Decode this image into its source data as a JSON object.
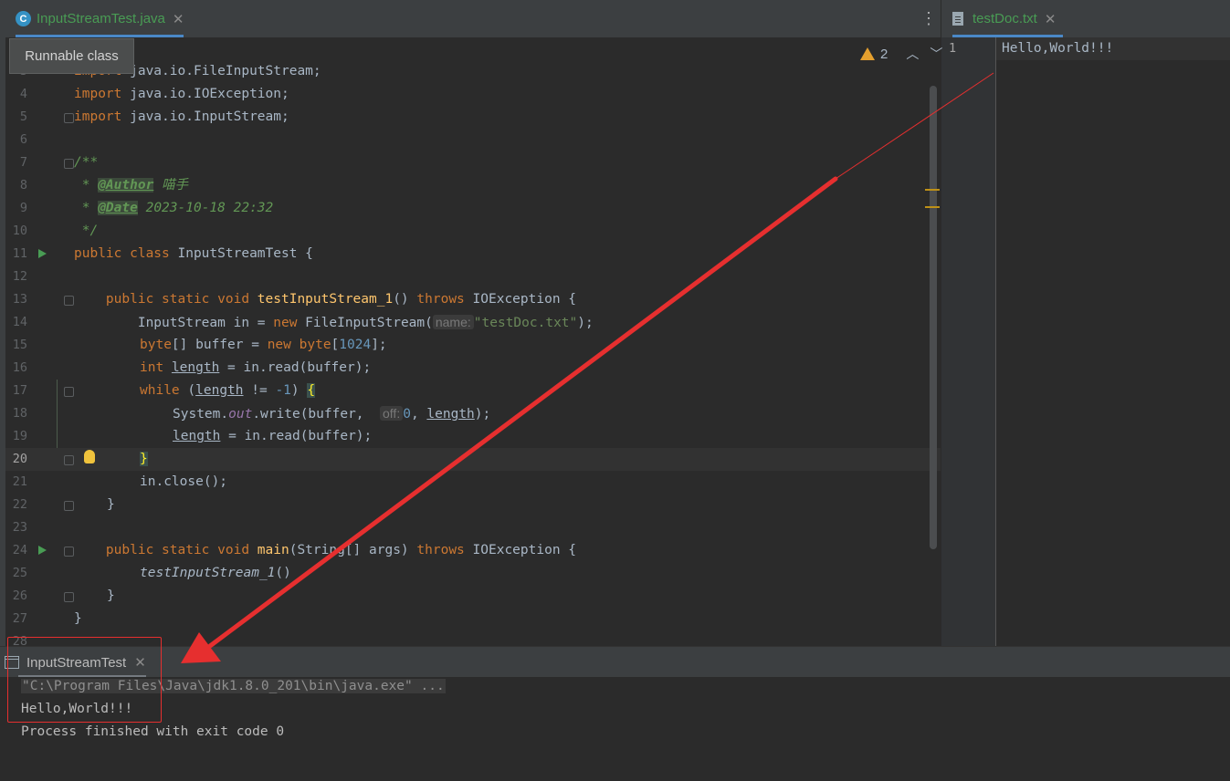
{
  "tabs_left": [
    {
      "label": "InputStreamTest.java",
      "active": true
    }
  ],
  "tabs_right": [
    {
      "label": "testDoc.txt",
      "active": true
    }
  ],
  "tooltip": "Runnable class",
  "warnings": {
    "count": "2"
  },
  "editor": {
    "current_line": "20",
    "lines": {
      "l3": {
        "num": "3",
        "a": "import",
        "b": " java.io.FileInputStream;"
      },
      "l4": {
        "num": "4",
        "a": "import",
        "b": " java.io.IOException;"
      },
      "l5": {
        "num": "5",
        "a": "import",
        "b": " java.io.InputStream;"
      },
      "l6": {
        "num": "6"
      },
      "l7": {
        "num": "7",
        "a": "/**"
      },
      "l8": {
        "num": "8",
        "a": " * ",
        "tag": "@Author",
        "b": " 喵手"
      },
      "l9": {
        "num": "9",
        "a": " * ",
        "tag": "@Date",
        "b": " 2023-10-18 22:32"
      },
      "l10": {
        "num": "10",
        "a": " */"
      },
      "l11": {
        "num": "11",
        "a": "public class",
        "b": " InputStreamTest {"
      },
      "l12": {
        "num": "12"
      },
      "l13": {
        "num": "13",
        "a": "    public static void ",
        "fn": "testInputStream_1",
        "b": "() ",
        "c": "throws",
        "d": " IOException {"
      },
      "l14": {
        "num": "14",
        "a": "        InputStream in = ",
        "b": "new",
        "c": " FileInputStream(",
        "hint": "name:",
        "str": "\"testDoc.txt\"",
        "d": ");"
      },
      "l15": {
        "num": "15",
        "a": "byte",
        "b": "[] buffer = ",
        "c": "new",
        "d": " ",
        "e": "byte",
        "f": "[",
        "n": "1024",
        "g": "];"
      },
      "l16": {
        "num": "16",
        "a": "int",
        "b": "length",
        "c": " = in.read(buffer);"
      },
      "l17": {
        "num": "17",
        "a": "while",
        "b": " (",
        "c": "length",
        "d": " != ",
        "n": "-1",
        "e": ") ",
        "f": "{"
      },
      "l18": {
        "num": "18",
        "a": "System.",
        "field": "out",
        "b": ".write(buffer, ",
        "hint": "off:",
        "n": "0",
        "c": ", ",
        "d": "length",
        "e": ");"
      },
      "l19": {
        "num": "19",
        "a": "length",
        "b": " = in.read(buffer);"
      },
      "l20": {
        "num": "20",
        "a": "}"
      },
      "l21": {
        "num": "21",
        "a": "in.close();"
      },
      "l22": {
        "num": "22",
        "a": "}"
      },
      "l23": {
        "num": "23"
      },
      "l24": {
        "num": "24",
        "a": "    public static void ",
        "fn": "main",
        "b": "(String[] args) ",
        "c": "throws",
        "d": " IOException {"
      },
      "l25": {
        "num": "25",
        "a": "testInputStream_1",
        "b": "()"
      },
      "l26": {
        "num": "26",
        "a": "}"
      },
      "l27": {
        "num": "27",
        "a": "}"
      },
      "l28": {
        "num": "28"
      }
    }
  },
  "right_editor": {
    "line_num": "1",
    "text": "Hello,World!!!"
  },
  "run": {
    "tab_label": "InputStreamTest",
    "console": {
      "cmd": "\"C:\\Program Files\\Java\\jdk1.8.0_201\\bin\\java.exe\" ...",
      "output": "Hello,World!!!",
      "exit": "Process finished with exit code 0"
    }
  },
  "colors": {
    "annotation": "#e62f2f",
    "keyword": "#cc7832",
    "function": "#ffc66d",
    "string": "#6a8759"
  }
}
